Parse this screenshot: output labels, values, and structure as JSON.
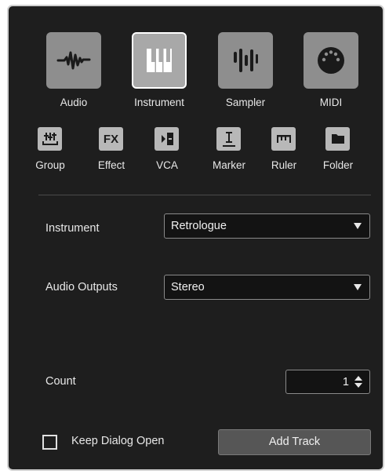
{
  "track_types": [
    {
      "label": "Audio",
      "icon": "audio-waveform-icon"
    },
    {
      "label": "Instrument",
      "icon": "piano-keys-icon",
      "selected": true
    },
    {
      "label": "Sampler",
      "icon": "sampler-bars-icon"
    },
    {
      "label": "MIDI",
      "icon": "midi-plug-icon"
    }
  ],
  "small_types": [
    {
      "label": "Group",
      "icon": "group-icon"
    },
    {
      "label": "Effect",
      "icon": "fx-icon",
      "glyph": "FX"
    },
    {
      "label": "VCA",
      "icon": "vca-icon"
    },
    {
      "label": "Marker",
      "icon": "marker-icon"
    },
    {
      "label": "Ruler",
      "icon": "ruler-icon"
    },
    {
      "label": "Folder",
      "icon": "folder-icon"
    }
  ],
  "instrument": {
    "label": "Instrument",
    "value": "Retrologue"
  },
  "audio_outputs": {
    "label": "Audio Outputs",
    "value": "Stereo"
  },
  "count": {
    "label": "Count",
    "value": "1"
  },
  "keep_dialog_open": {
    "label": "Keep Dialog Open",
    "checked": false
  },
  "add_track_button": "Add Track",
  "colors": {
    "background": "#1e1e1e",
    "tile": "#8e8e8e",
    "tile_selected": "#a8a8a8",
    "small_tile": "#b8b8b8",
    "button": "#565656"
  }
}
